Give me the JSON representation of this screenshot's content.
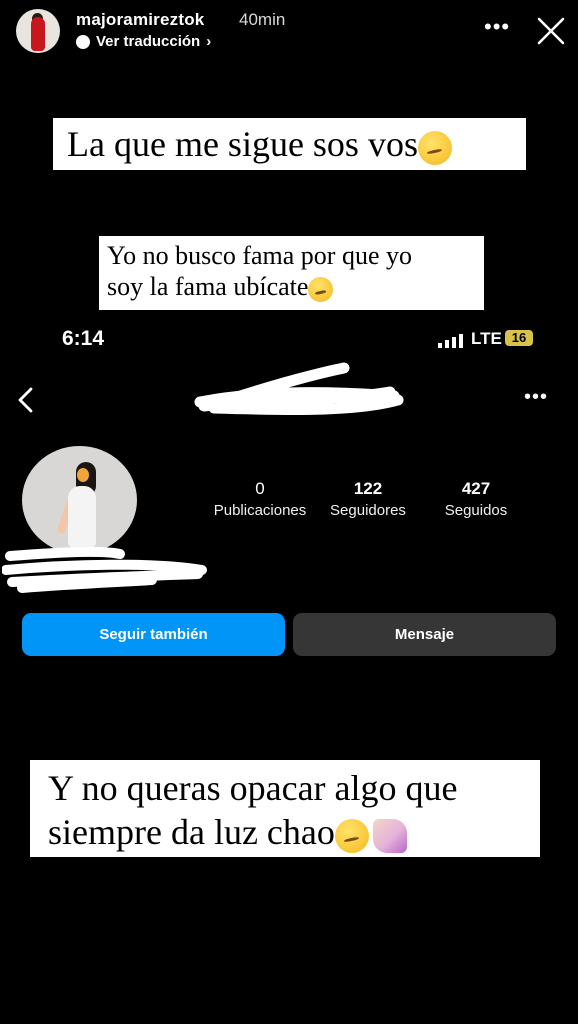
{
  "story": {
    "username": "majoramireztok",
    "time_ago": "40min",
    "translate_label": "Ver traducción",
    "translate_chevron": "›",
    "more_label": "•••",
    "close_icon": "close-icon"
  },
  "captions": {
    "top": "La que me sigue sos vos",
    "middle_line1": "Yo no busco fama por que yo",
    "middle_line2": "soy la fama ubícate",
    "bottom_line1": "Y no queras opacar algo que",
    "bottom_line2": "siempre da luz chao"
  },
  "phone_status": {
    "time": "6:14",
    "network": "LTE",
    "battery": "16"
  },
  "profile": {
    "more_label": "•••",
    "stats": [
      {
        "value": "0",
        "label": "Publicaciones"
      },
      {
        "value": "122",
        "label": "Seguidores"
      },
      {
        "value": "427",
        "label": "Seguidos"
      }
    ],
    "follow_button": "Seguir también",
    "message_button": "Mensaje"
  },
  "colors": {
    "follow_blue": "#0095f6",
    "message_gray": "#363636",
    "background": "#000000"
  }
}
